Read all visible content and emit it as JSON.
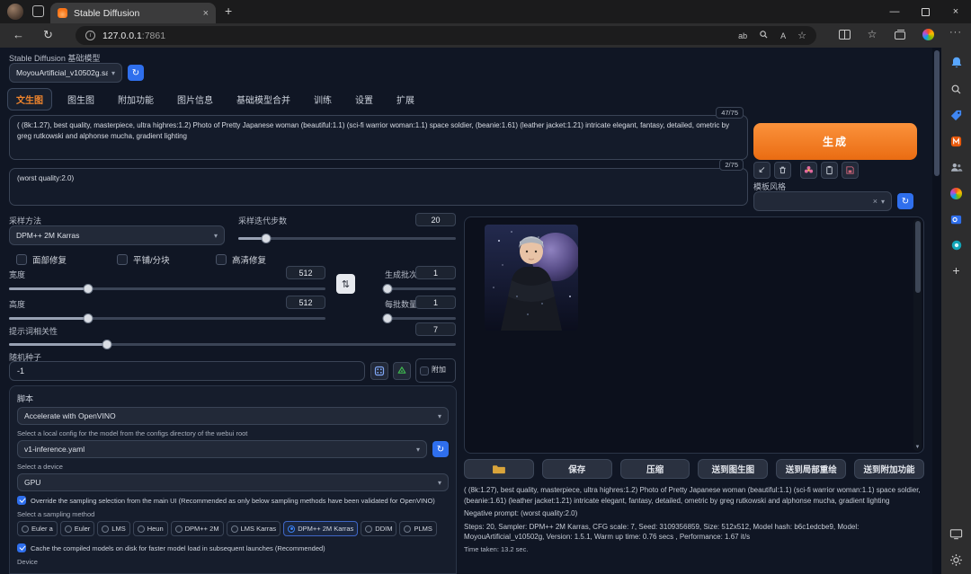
{
  "colors": {
    "accent_orange": "#ee7a1f",
    "accent_blue": "#2f6fed",
    "page_bg": "#101624"
  },
  "icons": {
    "caret": "▾",
    "back": "←",
    "refresh": "↻",
    "paste": "↙",
    "swap": "⇅",
    "plus": "+",
    "more": "···",
    "favorite": "☆",
    "close": "×",
    "minimize": "—",
    "new_tab": "+",
    "clear": "×",
    "scroll_down": "▼",
    "info": "i",
    "translate": "ab",
    "read_aloud": "A"
  },
  "browser": {
    "tab_title": "Stable Diffusion",
    "url_host": "127.0.0.1",
    "url_port": ":7861"
  },
  "header": {
    "checkpoint_label": "Stable Diffusion 基础模型",
    "checkpoint_value": "MoyouArtificial_v10502g.sa"
  },
  "tabs": [
    "文生图",
    "图生图",
    "附加功能",
    "图片信息",
    "基础模型合并",
    "训练",
    "设置",
    "扩展"
  ],
  "active_tab": "文生图",
  "prompt": {
    "text": "( (8k:1.27), best quality, masterpiece, ultra highres:1.2) Photo of Pretty Japanese woman (beautiful:1.1) (sci-fi warrior woman:1.1) space soldier, (beanie:1.61) (leather jacket:1.21) intricate elegant, fantasy, detailed, ometric by greg rutkowski and alphonse mucha, gradient lighting",
    "counter": "47/75"
  },
  "negative_prompt": {
    "text": "(worst quality:2.0)",
    "counter": "2/75"
  },
  "generate_label": "生成",
  "styles_label": "模板风格",
  "params": {
    "sampler_label": "采样方法",
    "sampler_value": "DPM++ 2M Karras",
    "steps_label": "采样迭代步数",
    "steps_value": "20",
    "restore_faces_label": "面部修复",
    "tiling_label": "平铺/分块",
    "hires_label": "高清修复",
    "width_label": "宽度",
    "width_value": "512",
    "height_label": "高度",
    "height_value": "512",
    "batch_count_label": "生成批次",
    "batch_count_value": "1",
    "batch_size_label": "每批数量",
    "batch_size_value": "1",
    "cfg_label": "提示词相关性",
    "cfg_value": "7",
    "seed_label": "随机种子",
    "seed_value": "-1",
    "seed_extra_label": "附加"
  },
  "script": {
    "label": "脚本",
    "value": "Accelerate with OpenVINO",
    "config_label": "Select a local config for the model from the configs directory of the webui root",
    "config_value": "v1-inference.yaml",
    "device_label": "Select a device",
    "device_value": "GPU",
    "override_text": "Override the sampling selection from the main UI (Recommended as only below sampling methods have been validated for OpenVINO)",
    "override_checked": true,
    "sampling_label": "Select a sampling method",
    "sampling_options": [
      "Euler a",
      "Euler",
      "LMS",
      "Heun",
      "DPM++ 2M",
      "LMS Karras",
      "DPM++ 2M Karras",
      "DDIM",
      "PLMS"
    ],
    "sampling_selected": "DPM++ 2M Karras",
    "cache_text": "Cache the compiled models on disk for faster model load in subsequent launches (Recommended)",
    "cache_checked": true,
    "device_footer_label": "Device"
  },
  "output": {
    "save_label": "保存",
    "zip_label": "压缩",
    "send_img2img_label": "送到图生图",
    "send_inpaint_label": "送到局部重绘",
    "send_extras_label": "送到附加功能",
    "info_prompt": "( (8k:1.27), best quality, masterpiece, ultra highres:1.2) Photo of Pretty Japanese woman (beautiful:1.1) (sci-fi warrior woman:1.1) space soldier, (beanie:1.61) (leather jacket:1.21) intricate elegant, fantasy, detailed, ometric by greg rutkowski and alphonse mucha, gradient lighting",
    "info_negative": "Negative prompt: (worst quality:2.0)",
    "info_params": "Steps: 20, Sampler: DPM++ 2M Karras, CFG scale: 7, Seed: 3109356859, Size: 512x512, Model hash: b6c1edcbe9, Model: MoyouArtificial_v10502g, Version: 1.5.1, Warm up time: 0.76 secs , Performance: 1.67 it/s",
    "time_taken": "Time taken: 13.2 sec."
  }
}
